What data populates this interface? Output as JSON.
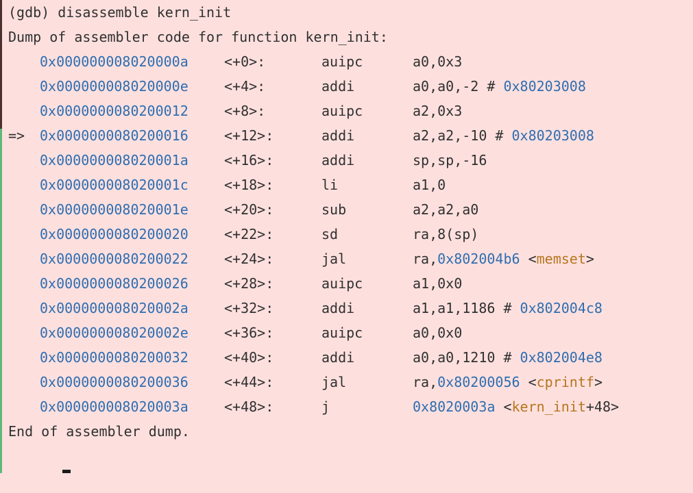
{
  "window": {
    "command": "(gdb) disassemble kern_init",
    "header": "Dump of assembler code for function kern_init:",
    "footer": "End of assembler dump."
  },
  "rows": [
    {
      "marker": "",
      "addr": "0x000000008020000a",
      "offset": "<+0>:",
      "mnemonic": "auipc",
      "ops": "a0,0x3",
      "ref": "",
      "sym_pre": "",
      "sym": "",
      "sym_post": ""
    },
    {
      "marker": "",
      "addr": "0x000000008020000e",
      "offset": "<+4>:",
      "mnemonic": "addi",
      "ops": "a0,a0,-2 # ",
      "ref": "0x80203008",
      "sym_pre": "",
      "sym": "",
      "sym_post": ""
    },
    {
      "marker": "",
      "addr": "0x0000000080200012",
      "offset": "<+8>:",
      "mnemonic": "auipc",
      "ops": "a2,0x3",
      "ref": "",
      "sym_pre": "",
      "sym": "",
      "sym_post": ""
    },
    {
      "marker": "=>",
      "addr": "0x0000000080200016",
      "offset": "<+12>:",
      "mnemonic": "addi",
      "ops": "a2,a2,-10 # ",
      "ref": "0x80203008",
      "sym_pre": "",
      "sym": "",
      "sym_post": ""
    },
    {
      "marker": "",
      "addr": "0x000000008020001a",
      "offset": "<+16>:",
      "mnemonic": "addi",
      "ops": "sp,sp,-16",
      "ref": "",
      "sym_pre": "",
      "sym": "",
      "sym_post": ""
    },
    {
      "marker": "",
      "addr": "0x000000008020001c",
      "offset": "<+18>:",
      "mnemonic": "li",
      "ops": "a1,0",
      "ref": "",
      "sym_pre": "",
      "sym": "",
      "sym_post": ""
    },
    {
      "marker": "",
      "addr": "0x000000008020001e",
      "offset": "<+20>:",
      "mnemonic": "sub",
      "ops": "a2,a2,a0",
      "ref": "",
      "sym_pre": "",
      "sym": "",
      "sym_post": ""
    },
    {
      "marker": "",
      "addr": "0x0000000080200020",
      "offset": "<+22>:",
      "mnemonic": "sd",
      "ops": "ra,8(sp)",
      "ref": "",
      "sym_pre": "",
      "sym": "",
      "sym_post": ""
    },
    {
      "marker": "",
      "addr": "0x0000000080200022",
      "offset": "<+24>:",
      "mnemonic": "jal",
      "ops": "ra,",
      "ref": "0x802004b6",
      "sym_pre": " <",
      "sym": "memset",
      "sym_post": ">"
    },
    {
      "marker": "",
      "addr": "0x0000000080200026",
      "offset": "<+28>:",
      "mnemonic": "auipc",
      "ops": "a1,0x0",
      "ref": "",
      "sym_pre": "",
      "sym": "",
      "sym_post": ""
    },
    {
      "marker": "",
      "addr": "0x000000008020002a",
      "offset": "<+32>:",
      "mnemonic": "addi",
      "ops": "a1,a1,1186 # ",
      "ref": "0x802004c8",
      "sym_pre": "",
      "sym": "",
      "sym_post": ""
    },
    {
      "marker": "",
      "addr": "0x000000008020002e",
      "offset": "<+36>:",
      "mnemonic": "auipc",
      "ops": "a0,0x0",
      "ref": "",
      "sym_pre": "",
      "sym": "",
      "sym_post": ""
    },
    {
      "marker": "",
      "addr": "0x0000000080200032",
      "offset": "<+40>:",
      "mnemonic": "addi",
      "ops": "a0,a0,1210 # ",
      "ref": "0x802004e8",
      "sym_pre": "",
      "sym": "",
      "sym_post": ""
    },
    {
      "marker": "",
      "addr": "0x0000000080200036",
      "offset": "<+44>:",
      "mnemonic": "jal",
      "ops": "ra,",
      "ref": "0x80200056",
      "sym_pre": " <",
      "sym": "cprintf",
      "sym_post": ">"
    },
    {
      "marker": "",
      "addr": "0x000000008020003a",
      "offset": "<+48>:",
      "mnemonic": "j",
      "ops": "",
      "ref": "0x8020003a",
      "sym_pre": " <",
      "sym": "kern_init",
      "sym_post": "+48>"
    }
  ],
  "colors": {
    "background": "#fde0de",
    "text": "#303030",
    "address": "#2f6db0",
    "symbol": "#b8751f"
  }
}
